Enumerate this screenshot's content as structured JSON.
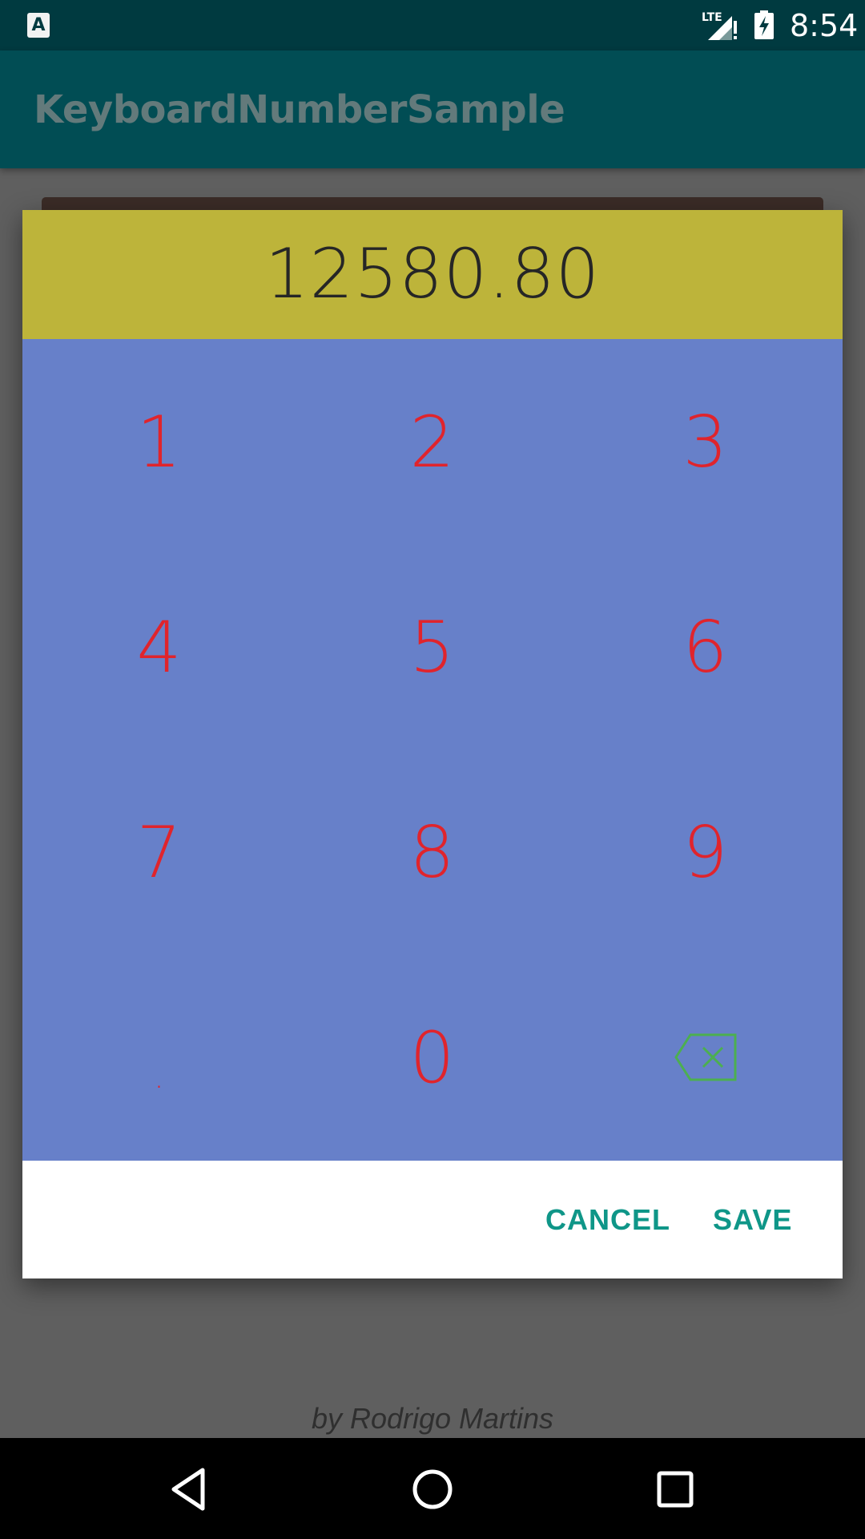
{
  "status_bar": {
    "time": "8:54",
    "network_label": "LTE",
    "icons": [
      "keyboard-a-icon",
      "signal-icon",
      "battery-charging-icon"
    ]
  },
  "app_bar": {
    "title": "KeyboardNumberSample"
  },
  "dialog": {
    "display_value": "12580.80",
    "keys": [
      {
        "label": "1"
      },
      {
        "label": "2"
      },
      {
        "label": "3"
      },
      {
        "label": "4"
      },
      {
        "label": "5"
      },
      {
        "label": "6"
      },
      {
        "label": "7"
      },
      {
        "label": "8"
      },
      {
        "label": "9"
      },
      {
        "label": "."
      },
      {
        "label": "0"
      },
      {
        "icon": "backspace-icon"
      }
    ],
    "cancel_label": "CANCEL",
    "save_label": "SAVE",
    "colors": {
      "display_bg": "#bdb43a",
      "keypad_bg": "#6780c9",
      "key_text": "#e0242c",
      "backspace": "#4caf50",
      "action_text": "#0f9688"
    }
  },
  "footer": {
    "credit": "by Rodrigo Martins"
  },
  "nav_bar": {
    "icons": [
      "back-icon",
      "home-icon",
      "recents-icon"
    ]
  }
}
